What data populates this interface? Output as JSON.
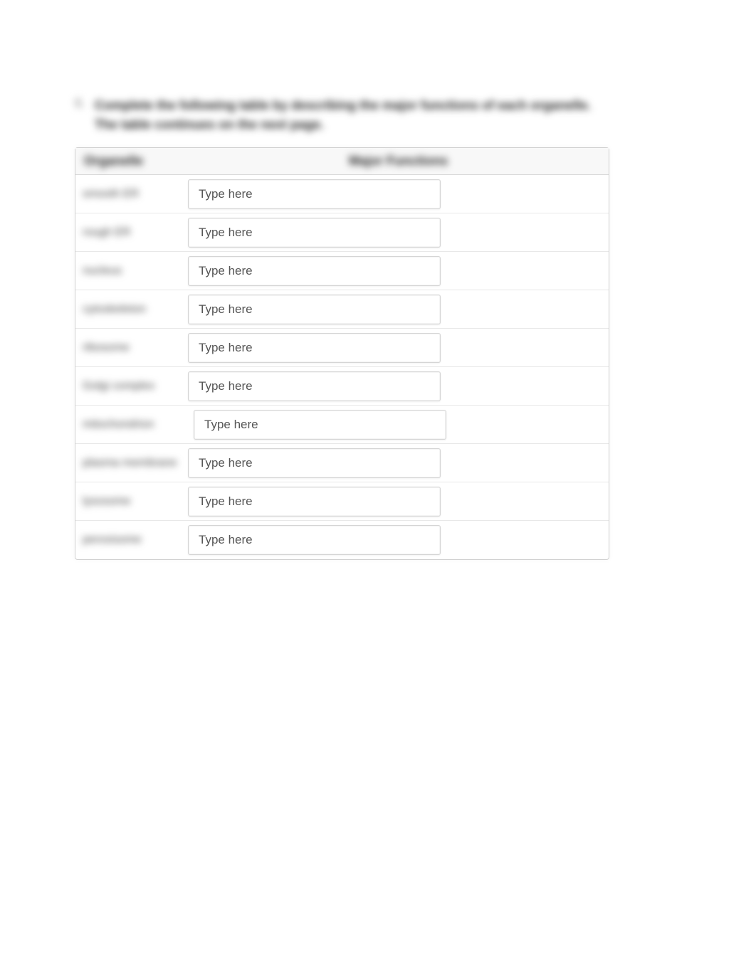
{
  "question": {
    "number": "6.",
    "text": "Complete the following table by describing the major functions of each organelle. The table continues on the next page."
  },
  "table": {
    "headers": {
      "col1": "Organelle",
      "col2": "Major Functions"
    },
    "rows": [
      {
        "label": "smooth ER",
        "placeholder": "Type here"
      },
      {
        "label": "rough ER",
        "placeholder": "Type here"
      },
      {
        "label": "nucleus",
        "placeholder": "Type here"
      },
      {
        "label": "cytoskeleton",
        "placeholder": "Type here"
      },
      {
        "label": "ribosome",
        "placeholder": "Type here"
      },
      {
        "label": "Golgi complex",
        "placeholder": "Type here"
      },
      {
        "label": "mitochondrion",
        "placeholder": "Type here"
      },
      {
        "label": "plasma membrane",
        "placeholder": "Type here"
      },
      {
        "label": "lysosome",
        "placeholder": "Type here"
      },
      {
        "label": "peroxisome",
        "placeholder": "Type here"
      }
    ]
  }
}
